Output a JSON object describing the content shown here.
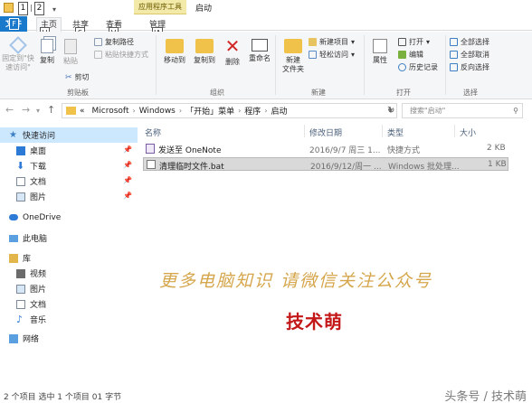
{
  "quick_access": {
    "key1": "1",
    "key2": "2"
  },
  "ribbon_tabs": {
    "file": "文件",
    "file_keytip": "F",
    "home": "主页",
    "home_keytip": "H",
    "share": "共享",
    "share_keytip": "S",
    "view": "查看",
    "view_keytip": "V",
    "manage": "管理",
    "manage_keytip": "JA",
    "context_group": "应用程序工具"
  },
  "window_title": "启动",
  "ribbon": {
    "clipboard": {
      "pin_quick_access": "固定到\"快速访问\"",
      "copy": "复制",
      "paste": "粘贴",
      "copy_path": "复制路径",
      "paste_shortcut": "粘贴快捷方式",
      "cut": "剪切",
      "label": "剪贴板"
    },
    "organize": {
      "move_to": "移动到",
      "copy_to": "复制到",
      "delete": "删除",
      "rename": "重命名",
      "label": "组织"
    },
    "new": {
      "new_folder": "新建\n文件夹",
      "new_item": "新建项目",
      "easy_access": "轻松访问",
      "label": "新建"
    },
    "open": {
      "properties": "属性",
      "open": "打开",
      "edit": "编辑",
      "history": "历史记录",
      "label": "打开"
    },
    "select": {
      "select_all": "全部选择",
      "select_none": "全部取消",
      "invert": "反向选择",
      "label": "选择"
    }
  },
  "address": {
    "prefix": "«",
    "crumbs": [
      "Microsoft",
      "Windows",
      "「开始」菜单",
      "程序",
      "启动"
    ],
    "search_placeholder": "搜索\"启动\""
  },
  "nav_pane": {
    "quick_access": "快速访问",
    "desktop": "桌面",
    "downloads": "下载",
    "documents": "文档",
    "pictures": "图片",
    "onedrive": "OneDrive",
    "this_pc": "此电脑",
    "library": "库",
    "lib_videos": "视频",
    "lib_pictures": "图片",
    "lib_documents": "文档",
    "lib_music": "音乐",
    "network": "网络"
  },
  "file_list": {
    "headers": {
      "name": "名称",
      "modified": "修改日期",
      "type": "类型",
      "size": "大小"
    },
    "rows": [
      {
        "name": "发送至 OneNote",
        "modified": "2016/9/7 周三 1...",
        "type": "快捷方式",
        "size": "2 KB"
      },
      {
        "name": "清理临时文件.bat",
        "modified": "2016/9/12/周一 ...",
        "type": "Windows 批处理...",
        "size": "1 KB"
      }
    ]
  },
  "overlay": {
    "line1": "更多电脑知识 请微信关注公众号",
    "line2": "技术萌"
  },
  "status_bar": "2 个项目    选中 1 个项目  01 字节",
  "credit": "头条号 / 技术萌"
}
